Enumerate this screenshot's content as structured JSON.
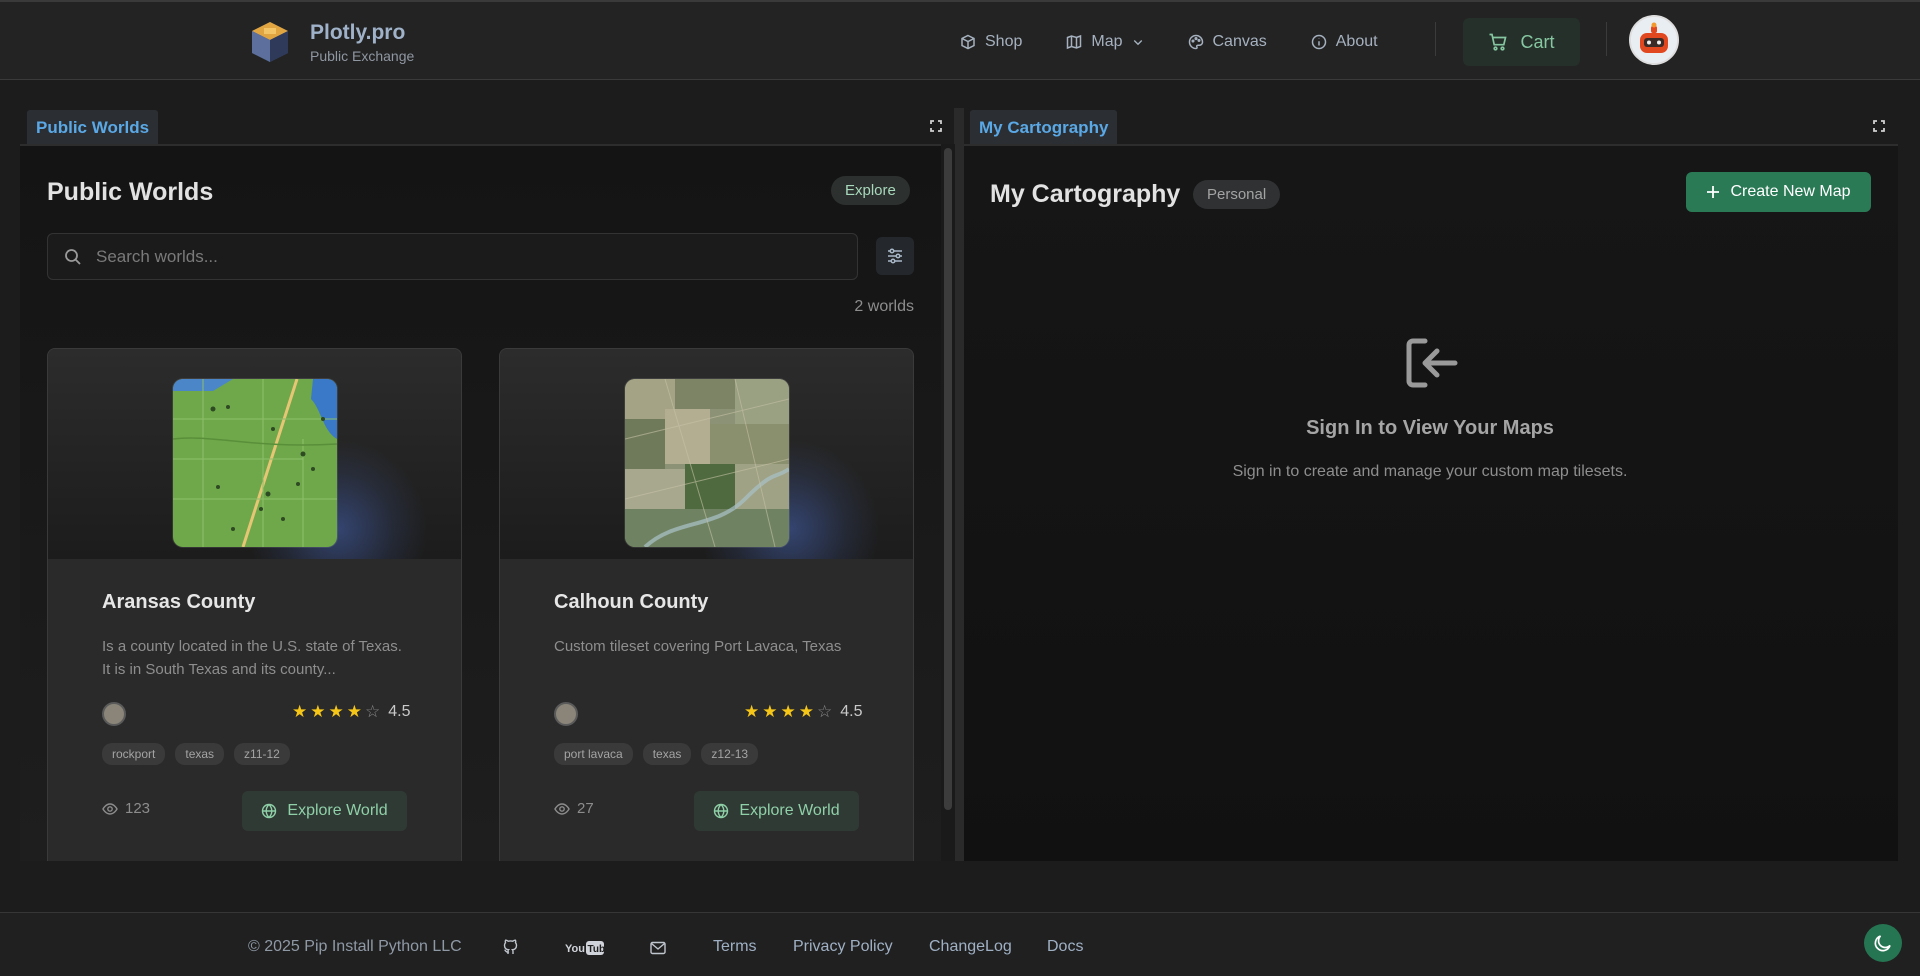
{
  "brand": {
    "name": "Plotly.pro",
    "subtitle": "Public Exchange"
  },
  "nav": {
    "shop": "Shop",
    "map": "Map",
    "canvas": "Canvas",
    "about": "About",
    "cart": "Cart"
  },
  "left_panel": {
    "tab": "Public Worlds",
    "title": "Public Worlds",
    "badge": "Explore",
    "search_placeholder": "Search worlds...",
    "count": "2 worlds",
    "cards": [
      {
        "title": "Aransas County",
        "description": "Is a county located in the U.S. state of Texas. It is in South Texas and its county...",
        "rating": "4.5",
        "rating_value": 4.5,
        "tags": [
          "rockport",
          "texas",
          "z11-12"
        ],
        "views": "123",
        "button": "Explore World"
      },
      {
        "title": "Calhoun County",
        "description": "Custom tileset covering Port Lavaca, Texas",
        "rating": "4.5",
        "rating_value": 4.5,
        "tags": [
          "port lavaca",
          "texas",
          "z12-13"
        ],
        "views": "27",
        "button": "Explore World"
      }
    ]
  },
  "right_panel": {
    "tab": "My Cartography",
    "title": "My Cartography",
    "badge": "Personal",
    "create_button": "Create New Map",
    "signin_title": "Sign In to View Your Maps",
    "signin_desc": "Sign in to create and manage your custom map tilesets."
  },
  "footer": {
    "copyright": "© 2025 Pip Install Python LLC",
    "links": [
      "Terms",
      "Privacy Policy",
      "ChangeLog",
      "Docs"
    ]
  },
  "colors": {
    "accent_green": "#2b7a56",
    "tab_blue": "#5aa8e6",
    "star": "#f5c518"
  },
  "icons": [
    "github-icon",
    "youtube-icon",
    "mail-icon",
    "moon-icon",
    "search-icon",
    "filter-icon",
    "cart-icon",
    "eye-icon",
    "globe-icon",
    "sign-in-icon"
  ]
}
